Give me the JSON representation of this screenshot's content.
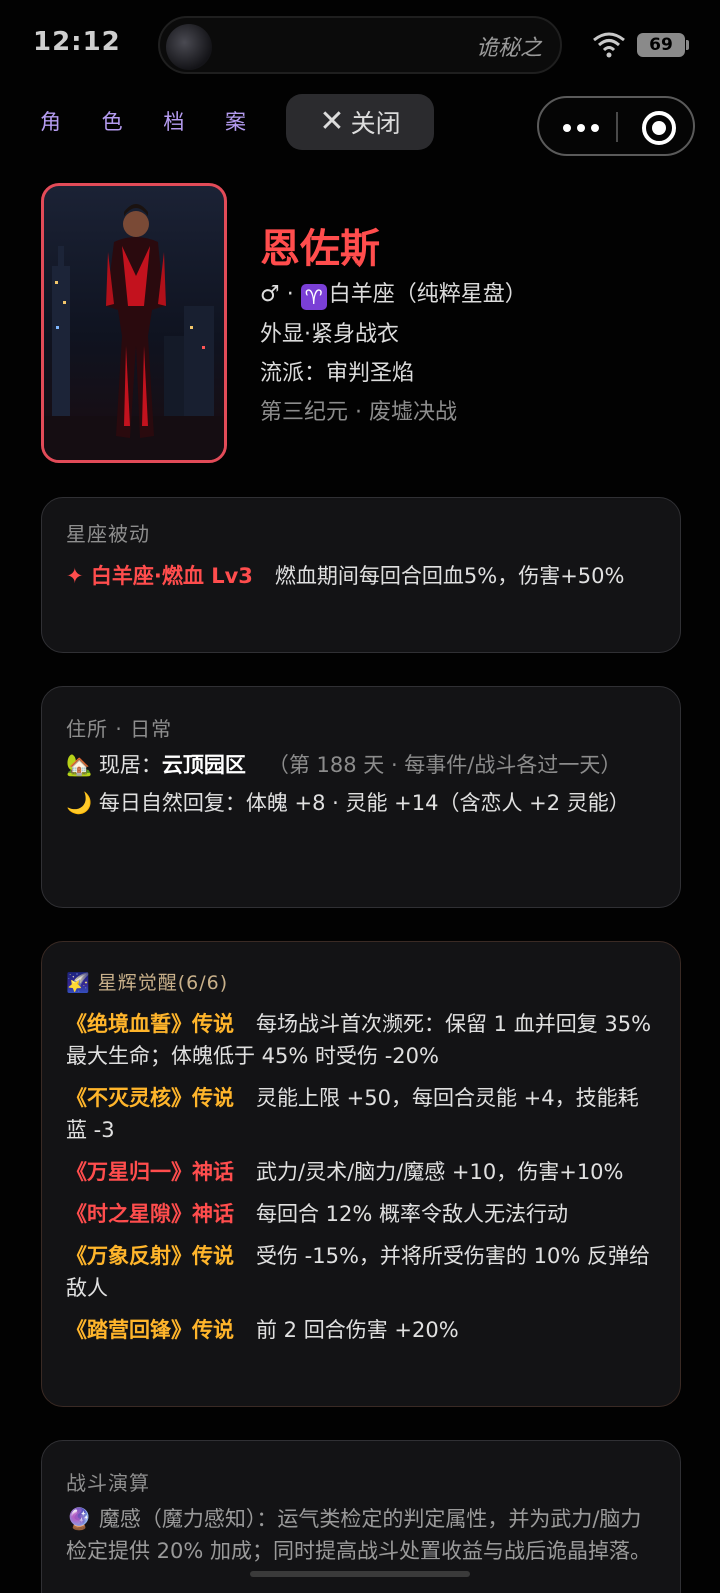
{
  "status": {
    "time": "12:12",
    "island_text": "诡秘之",
    "battery": "69",
    "colors": {
      "battery": "#8a8a8a"
    }
  },
  "nav": {
    "title": "角 色 档 案",
    "close_label": "关闭",
    "icons": [
      "close-icon",
      "more-icon",
      "target-icon"
    ]
  },
  "profile": {
    "name": "恩佐斯",
    "gender_symbol": "♂",
    "separator": "·",
    "zodiac_icon": "♈",
    "zodiac": "白羊座（纯粹星盘）",
    "appearance": "外显·紧身战衣",
    "school": "流派：审判圣焰",
    "era": "第三纪元 · 废墟决战",
    "colors": {
      "name": "#ff4d4d",
      "portrait_border": "#e24b58"
    }
  },
  "passive": {
    "title": "星座被动",
    "skill_name": "✦ 白羊座·燃血 Lv3",
    "skill_desc": "燃血期间每回合回血5%，伤害+50%"
  },
  "residence": {
    "title": "住所 · 日常",
    "home_icon": "🏡",
    "home_label": "现居：",
    "home_name": "云顶园区",
    "home_note": "（第 188 天 · 每事件/战斗各过一天）",
    "moon_icon": "🌙",
    "recovery": "每日自然回复：体魄 +8 · 灵能 +14（含恋人 +2 灵能）"
  },
  "awakening": {
    "icon": "🌠",
    "title": "星辉觉醒(6/6)",
    "items": [
      {
        "name": "《绝境血誓》传说",
        "desc": "每场战斗首次濒死：保留 1 血并回复 35% 最大生命；体魄低于 45% 时受伤 -20%"
      },
      {
        "name": "《不灭灵核》传说",
        "desc": "灵能上限 +50，每回合灵能 +4，技能耗蓝 -3"
      },
      {
        "name": "《万星归一》神话",
        "desc": "武力/灵术/脑力/魔感 +10，伤害+10%"
      },
      {
        "name": "《时之星隙》神话",
        "desc": "每回合 12% 概率令敌人无法行动"
      },
      {
        "name": "《万象反射》传说",
        "desc": "受伤 -15%，并将所受伤害的 10% 反弹给敌人"
      },
      {
        "name": "《踏营回锋》传说",
        "desc": "前 2 回合伤害 +20%"
      }
    ],
    "colors": {
      "legend": "#ffb52b",
      "myth": "#ff4d4d"
    }
  },
  "battle": {
    "title": "战斗演算",
    "icon": "🔮",
    "text": "魔感（魔力感知）：运气类检定的判定属性，并为武力/脑力检定提供 20% 加成；同时提高战斗处置收益与战后诡晶掉落。"
  }
}
